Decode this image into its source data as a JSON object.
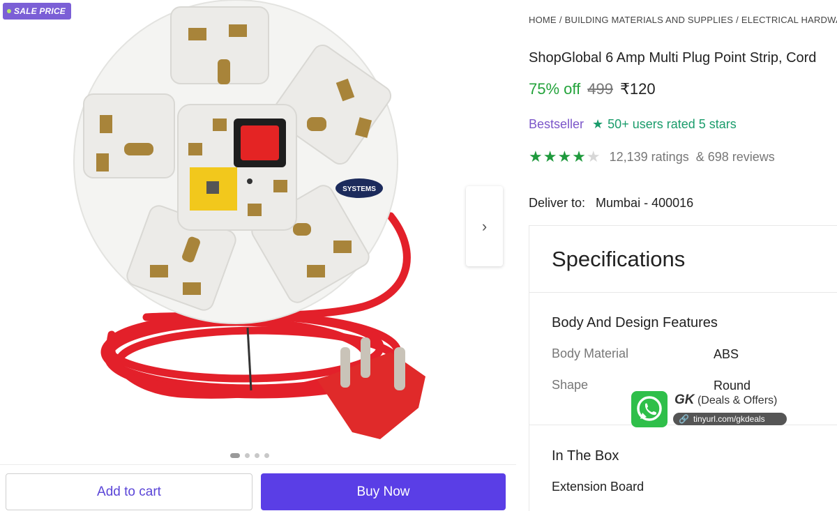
{
  "gallery": {
    "sale_badge": "SALE PRICE",
    "brand_mark": "SYSTEMS",
    "dots": 4,
    "active_dot": 1
  },
  "actions": {
    "add_to_cart": "Add to cart",
    "buy_now": "Buy Now"
  },
  "breadcrumb": [
    "HOME",
    "BUILDING MATERIALS AND SUPPLIES",
    "ELECTRICAL HARDWARE"
  ],
  "product": {
    "title": "ShopGlobal 6 Amp Multi Plug Point Strip, Cord",
    "discount": "75% off",
    "mrp": "499",
    "price": "₹120",
    "bestseller": "Bestseller",
    "rated_text": "50+ users rated 5 stars",
    "stars_filled": 4,
    "stars_total": 5,
    "ratings": "12,139 ratings",
    "reviews": "& 698 reviews"
  },
  "delivery": {
    "label": "Deliver to:",
    "location": "Mumbai - 400016"
  },
  "specifications": {
    "heading": "Specifications",
    "body_section": "Body And Design Features",
    "body_material_key": "Body Material",
    "body_material_val": "ABS",
    "shape_key": "Shape",
    "shape_val": "Round",
    "in_box_section": "In The Box",
    "in_box_item": "Extension Board"
  },
  "watermark": {
    "brand": "GK",
    "tagline": "(Deals & Offers)",
    "link": "tinyurl.com/gkdeals"
  },
  "colors": {
    "accent": "#5a3ee6",
    "discount": "#23a33b",
    "bestseller": "#7b55c9",
    "rated": "#1a9c6b",
    "cord": "#e3202a",
    "body": "#f4f4f2"
  }
}
